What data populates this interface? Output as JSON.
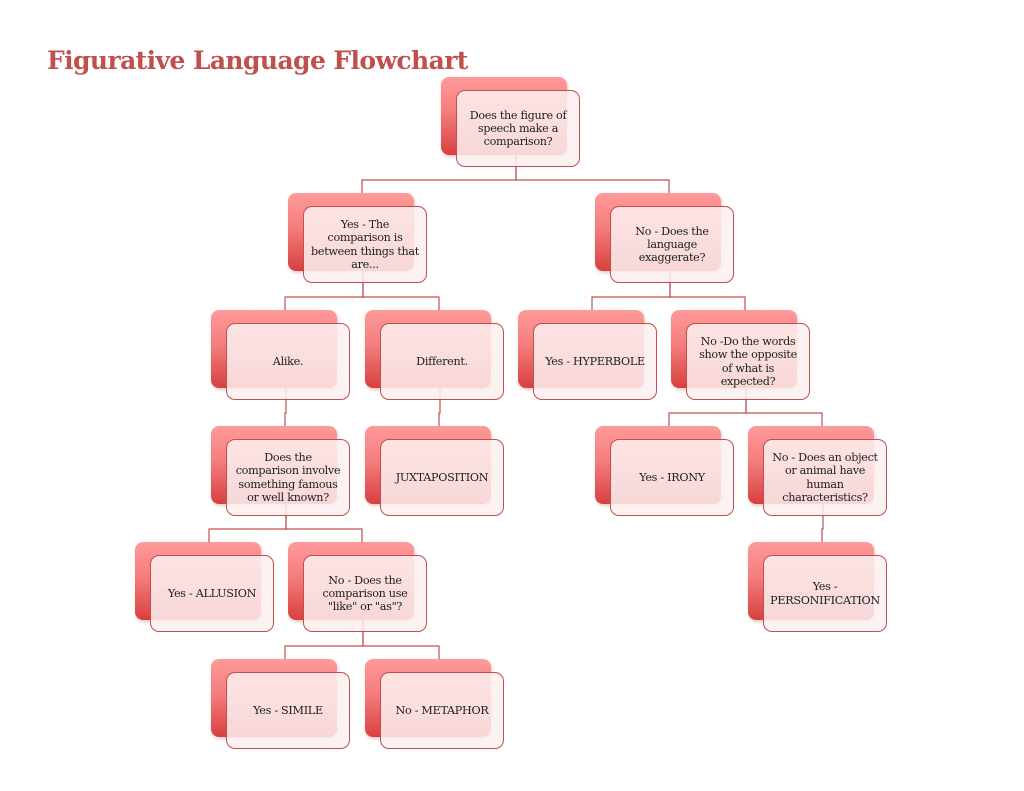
{
  "title": "Figurative Language Flowchart",
  "colors": {
    "accent": "#c0504d",
    "box_top": "#ff9a9a",
    "box_bottom": "#d8403f",
    "front_fill": "#fdf0f0"
  },
  "nodes": {
    "root": "Does the figure of speech make a comparison?",
    "yes_comparison": "Yes - The comparison is between things that are...",
    "no_exaggerate": "No - Does the language exaggerate?",
    "alike": "Alike.",
    "different": "Different.",
    "hyperbole": "Yes - HYPERBOLE",
    "opposite_q": "No -Do the words show the opposite of what is expected?",
    "famous_q": "Does the comparison involve something famous or well known?",
    "juxtaposition": "JUXTAPOSITION",
    "irony": "Yes - IRONY",
    "human_q": "No - Does an object or animal have human characteristics?",
    "allusion": "Yes - ALLUSION",
    "like_as_q": "No - Does the comparison use \"like\" or \"as\"?",
    "personification": "Yes - PERSONIFICATION",
    "simile": "Yes - SIMILE",
    "metaphor": "No - METAPHOR"
  },
  "edges": [
    [
      "root",
      "yes_comparison"
    ],
    [
      "root",
      "no_exaggerate"
    ],
    [
      "yes_comparison",
      "alike"
    ],
    [
      "yes_comparison",
      "different"
    ],
    [
      "no_exaggerate",
      "hyperbole"
    ],
    [
      "no_exaggerate",
      "opposite_q"
    ],
    [
      "alike",
      "famous_q"
    ],
    [
      "different",
      "juxtaposition"
    ],
    [
      "opposite_q",
      "irony"
    ],
    [
      "opposite_q",
      "human_q"
    ],
    [
      "famous_q",
      "allusion"
    ],
    [
      "famous_q",
      "like_as_q"
    ],
    [
      "human_q",
      "personification"
    ],
    [
      "like_as_q",
      "simile"
    ],
    [
      "like_as_q",
      "metaphor"
    ]
  ]
}
